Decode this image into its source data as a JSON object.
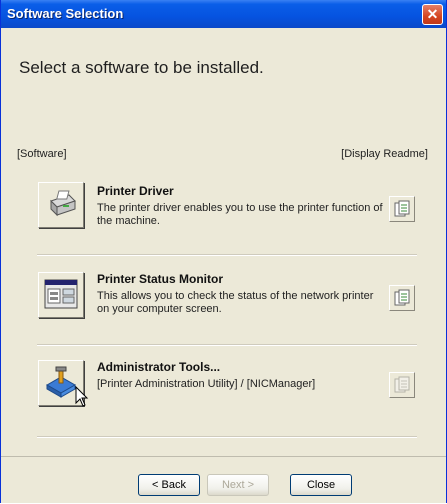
{
  "window": {
    "title": "Software Selection"
  },
  "header": {
    "heading": "Select a software to be installed."
  },
  "columns": {
    "software": "[Software]",
    "readme": "[Display Readme]"
  },
  "items": [
    {
      "title": "Printer Driver",
      "desc": "The printer driver enables you to use the printer function of the machine.",
      "icon": "printer-icon",
      "readme_enabled": true
    },
    {
      "title": "Printer Status Monitor",
      "desc": "This allows you to check the status of the network printer on your computer screen.",
      "icon": "status-monitor-icon",
      "readme_enabled": true
    },
    {
      "title": "Administrator Tools...",
      "desc": "[Printer Administration Utility] / [NICManager]",
      "icon": "admin-tools-icon",
      "readme_enabled": false
    }
  ],
  "buttons": {
    "back": "< Back",
    "next": "Next >",
    "close": "Close"
  },
  "colors": {
    "titlebar": "#0653e0",
    "close": "#d54520",
    "panel": "#ece9d8"
  }
}
